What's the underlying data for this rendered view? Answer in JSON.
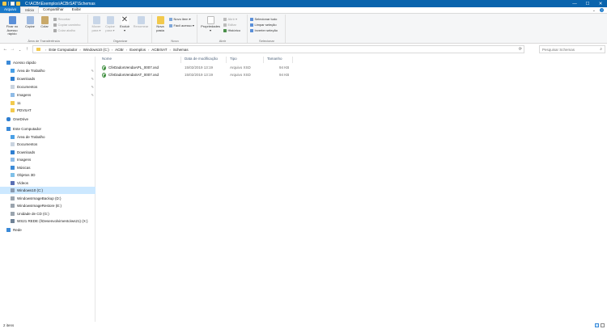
{
  "window": {
    "title": "C:\\ACBr\\Exemplos\\ACBrSAT\\Schemas",
    "controls": [
      "—",
      "☐",
      "✕"
    ],
    "controls_icons": [
      "minimize-icon",
      "maximize-icon",
      "close-icon"
    ]
  },
  "ribbon_tabs": [
    "Arquivo",
    "Início",
    "Compartilhar",
    "Exibir"
  ],
  "ribbon_tabs_active": 1,
  "ribbon": {
    "groups": {
      "clipboard": "Área de Transferência",
      "organize": "Organizar",
      "new": "Novo",
      "open": "Abrir",
      "select": "Selecionar"
    },
    "pin_quick_access": "Fixar no\nAcesso rápido",
    "copy": "Copiar",
    "paste": "Colar",
    "cut": "Recortar",
    "copy_path": "Copiar caminho",
    "paste_shortcut": "Colar atalho",
    "move_to": "Mover\npara ▾",
    "copy_to": "Copiar\npara ▾",
    "delete": "Excluir\n▾",
    "rename": "Renomear",
    "new_folder": "Nova\npasta",
    "new_item": "Novo item ▾",
    "easy_access": "Fácil acesso ▾",
    "properties": "Propriedades\n▾",
    "open_btn": "Abrir ▾",
    "edit": "Editar",
    "history": "Histórico",
    "select_all": "Selecionar tudo",
    "select_none": "Limpar seleção",
    "invert_selection": "Inverter seleção"
  },
  "address": {
    "crumbs": [
      "Este Computador",
      "Windows10 (C:)",
      "ACBr",
      "Exemplos",
      "ACBrSAT",
      "Schemas"
    ],
    "search_placeholder": "Pesquisar Schemas"
  },
  "nav": {
    "quick_access": "Acesso rápido",
    "quick_items": [
      "Área de Trabalho",
      "Downloads",
      "Documentos",
      "Imagens",
      "11",
      "PDVSAT"
    ],
    "onedrive": "OneDrive",
    "this_pc": "Este Computador",
    "pc_items": [
      "Área de Trabalho",
      "Documentos",
      "Downloads",
      "Imagens",
      "Músicas",
      "Objetos 3D",
      "Vídeos",
      "Windows10 (C:)",
      "WindowsImageBackup (D:)",
      "WindowsImageRestore (E:)",
      "Unidade de CD (G:)",
      "WS21 REDE (\\\\Desenvolvimento\\ws21) (X:)"
    ],
    "network": "Rede"
  },
  "columns": {
    "name": "Nome",
    "modified": "Data de modificação",
    "type": "Tipo",
    "size": "Tamanho"
  },
  "files": [
    {
      "name": "CfeDadosVendaAPL_0007.xsd",
      "modified": "15/02/2019 13:19",
      "type": "Arquivo XSD",
      "size": "94 KB"
    },
    {
      "name": "CfeDadosVendaSAT_0007.xsd",
      "modified": "15/02/2019 13:19",
      "type": "Arquivo XSD",
      "size": "94 KB"
    }
  ],
  "status": {
    "count": "2 itens"
  },
  "colors": {
    "titlebar": "#0a64ad",
    "selection": "#cce8ff",
    "accent": "#1979ca"
  }
}
